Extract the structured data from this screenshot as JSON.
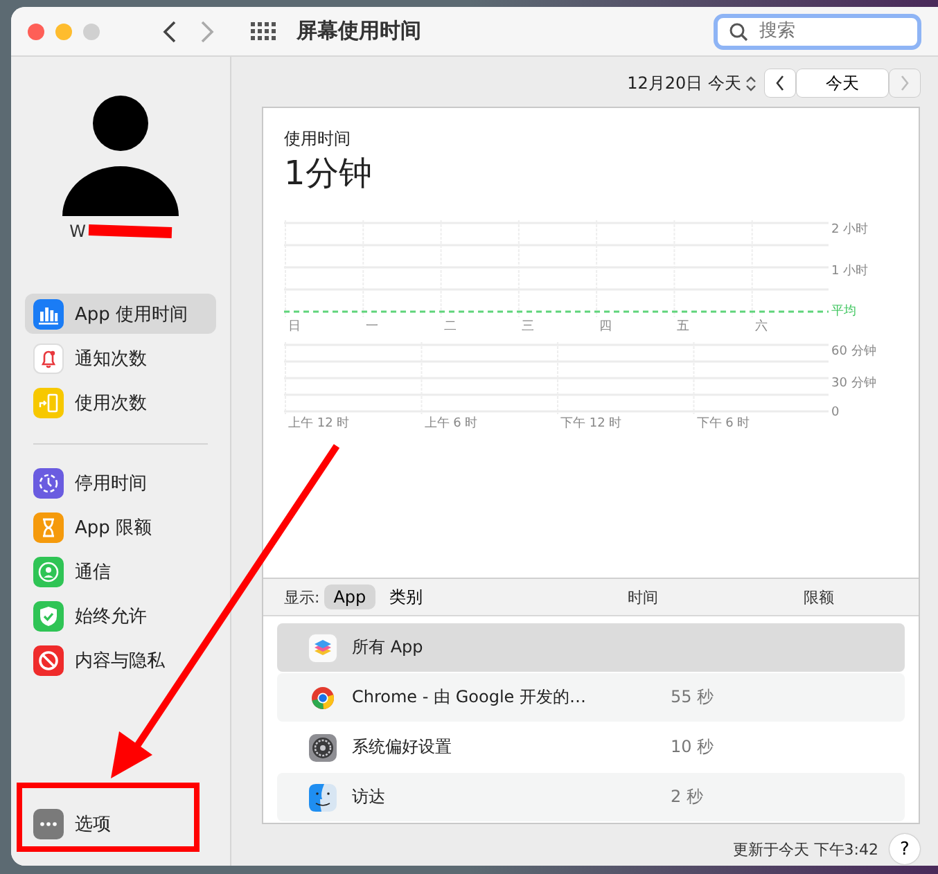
{
  "window": {
    "title": "屏幕使用时间"
  },
  "search": {
    "placeholder": "搜索"
  },
  "user": {
    "name": "W"
  },
  "sidebar": {
    "groups": [
      [
        {
          "label": "App 使用时间",
          "selected": true
        },
        {
          "label": "通知次数",
          "selected": false
        },
        {
          "label": "使用次数",
          "selected": false
        }
      ],
      [
        {
          "label": "停用时间",
          "selected": false
        },
        {
          "label": "App 限额",
          "selected": false
        },
        {
          "label": "通信",
          "selected": false
        },
        {
          "label": "始终允许",
          "selected": false
        },
        {
          "label": "内容与隐私",
          "selected": false
        }
      ]
    ],
    "options": {
      "label": "选项"
    }
  },
  "date": {
    "label": "12月20日 今天",
    "today_button": "今天"
  },
  "usage": {
    "title": "使用时间",
    "total": "1分钟",
    "week_chart": {
      "days": [
        "日",
        "一",
        "二",
        "三",
        "四",
        "五",
        "六"
      ],
      "y_labels": [
        "2 小时",
        "1 小时"
      ],
      "average_label": "平均"
    },
    "hour_chart": {
      "times": [
        "上午 12 时",
        "上午 6 时",
        "下午 12 时",
        "下午 6 时"
      ],
      "y_labels": [
        "60 分钟",
        "30 分钟",
        "0"
      ]
    }
  },
  "table": {
    "show_label": "显示:",
    "filters": [
      {
        "label": "App",
        "selected": true
      },
      {
        "label": "类别",
        "selected": false
      }
    ],
    "columns": [
      "时间",
      "限额"
    ],
    "rows": [
      {
        "name": "所有 App",
        "selected": true
      },
      {
        "name": "Chrome - 由 Google 开发的…",
        "time": "55 秒",
        "selected": false
      },
      {
        "name": "系统偏好设置",
        "time": "10 秒",
        "selected": false
      },
      {
        "name": "访达",
        "time": "2 秒",
        "selected": false
      }
    ]
  },
  "footer": {
    "updated": "更新于今天 下午3:42",
    "help": "?"
  }
}
